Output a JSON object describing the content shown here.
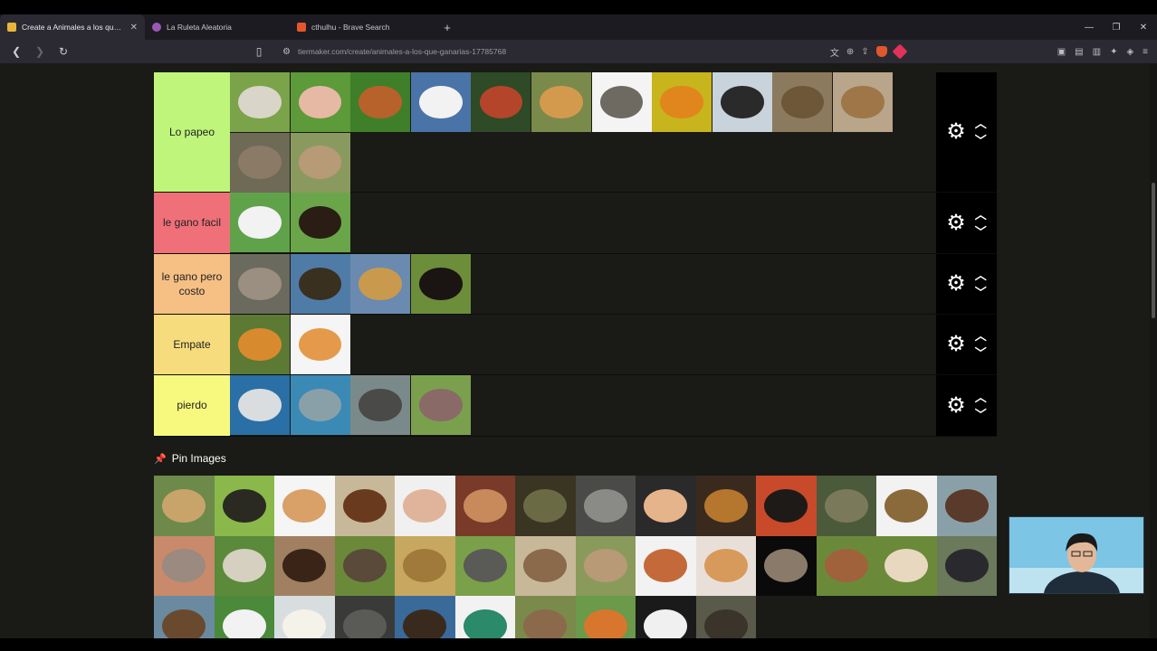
{
  "browser": {
    "tabs": [
      {
        "title": "Create a Animales a los que ganarias",
        "active": true,
        "favicon_color": "#e8b53a"
      },
      {
        "title": "La Ruleta Aleatoria",
        "active": false,
        "favicon_color": "#9b59b6"
      },
      {
        "title": "cthulhu - Brave Search",
        "active": false,
        "favicon_color": "#e2572b"
      }
    ],
    "new_tab": "+",
    "controls": {
      "minimize": "—",
      "maximize": "❐",
      "close": "✕"
    },
    "url": "tiermaker.com/create/animales-a-los-que-ganarias-17785768"
  },
  "tiers": [
    {
      "label": "Lo papeo",
      "color": "#bff57a",
      "items": [
        "sheep",
        "pig",
        "hen",
        "swan",
        "rooster",
        "golden-retriever",
        "greyhound",
        "butterfly",
        "penguins",
        "kangaroo",
        "coyote",
        "lynx",
        "rabbit"
      ]
    },
    {
      "label": "le gano facil",
      "color": "#f0707a",
      "items": [
        "cow",
        "doberman"
      ]
    },
    {
      "label": "le gano pero costo",
      "color": "#f6bf84",
      "items": [
        "wolf",
        "ostrich",
        "giraffe",
        "tasmanian-devil"
      ]
    },
    {
      "label": "Empate",
      "color": "#f7dc7d",
      "items": [
        "tiger",
        "cat"
      ]
    },
    {
      "label": "pierdo",
      "color": "#f7f97e",
      "items": [
        "shark",
        "seal",
        "rhinoceros",
        "hippo"
      ]
    }
  ],
  "pin": {
    "label": "Pin Images",
    "icon": "pin-icon"
  },
  "pool": [
    "cheetah",
    "beetle",
    "chihuahua",
    "ant",
    "man",
    "bruce-lee",
    "old-painting",
    "gigachad",
    "child",
    "lion",
    "bull",
    "crocodile",
    "tortoise",
    "moose",
    "armadillo",
    "cobra",
    "tarantula",
    "anteater",
    "frog",
    "elephant",
    "hyena",
    "meerkats",
    "guinea-pig",
    "hamster",
    "rat",
    "capybara",
    "capuchin",
    "gorilla",
    "bear",
    "panda",
    "polar-bear",
    "rock",
    "eagle",
    "hummingbird",
    "sparrow",
    "robin",
    "pelican",
    "hedgehog"
  ],
  "tile_colors": {
    "sheep": [
      "#7ba34a",
      "#d9d5c8"
    ],
    "pig": [
      "#5c9a3a",
      "#e6b9a4"
    ],
    "hen": [
      "#3f7f2a",
      "#b8622b"
    ],
    "swan": [
      "#4a73a8",
      "#f2f2f2"
    ],
    "rooster": [
      "#2f4a26",
      "#b5452a"
    ],
    "golden-retriever": [
      "#7a8a4a",
      "#d39a4e"
    ],
    "greyhound": [
      "#f4f4f4",
      "#6e6a62"
    ],
    "butterfly": [
      "#c8b41c",
      "#e0861c"
    ],
    "penguins": [
      "#c9d3dc",
      "#2a2a2a"
    ],
    "kangaroo": [
      "#8b7a5e",
      "#6e5638"
    ],
    "coyote": [
      "#b9a58a",
      "#9e7648"
    ],
    "lynx": [
      "#6e6a56",
      "#8a7a66"
    ],
    "rabbit": [
      "#8a9a5e",
      "#b79a76"
    ],
    "cow": [
      "#5fa24a",
      "#f2f2f2"
    ],
    "doberman": [
      "#6aa54a",
      "#2a1d14"
    ],
    "wolf": [
      "#6a6a5e",
      "#9a8f80"
    ],
    "ostrich": [
      "#4f7ca6",
      "#3a3020"
    ],
    "giraffe": [
      "#6a8ab0",
      "#c99a4e"
    ],
    "tasmanian-devil": [
      "#6c8d3a",
      "#1a1412"
    ],
    "tiger": [
      "#5c7a34",
      "#d88a2e"
    ],
    "cat": [
      "#f5f5f5",
      "#e49a4a"
    ],
    "shark": [
      "#2a6fa6",
      "#d9dde0"
    ],
    "seal": [
      "#3a8ab5",
      "#8aa0a8"
    ],
    "rhinoceros": [
      "#7a8a8a",
      "#4a4a48"
    ],
    "hippo": [
      "#7aa04e",
      "#8a6a66"
    ],
    "cheetah": [
      "#6d8a4a",
      "#c9a46a"
    ],
    "beetle": [
      "#8ab84a",
      "#2a2a22"
    ],
    "chihuahua": [
      "#f5f5f5",
      "#d9a068"
    ],
    "ant": [
      "#c8b89a",
      "#6a3a1e"
    ],
    "man": [
      "#f0f0f0",
      "#e0b49a"
    ],
    "bruce-lee": [
      "#7a3a2a",
      "#c88a5a"
    ],
    "old-painting": [
      "#3a3422",
      "#6a6a44"
    ],
    "gigachad": [
      "#4a4a48",
      "#8a8a86"
    ],
    "child": [
      "#2a2a2a",
      "#e6b48a"
    ],
    "lion": [
      "#3a2a1e",
      "#b5762e"
    ],
    "bull": [
      "#c84a2a",
      "#1e1a18"
    ],
    "crocodile": [
      "#4a5a3a",
      "#7a7a5a"
    ],
    "tortoise": [
      "#f2f2f2",
      "#8a6a3a"
    ],
    "moose": [
      "#8aa0a8",
      "#5a3a2a"
    ],
    "armadillo": [
      "#c88a6a",
      "#9a8a80"
    ],
    "cobra": [
      "#5a8a3a",
      "#d6d0c0"
    ],
    "tarantula": [
      "#a08060",
      "#3a2418"
    ],
    "anteater": [
      "#6a8a3a",
      "#5a4a3a"
    ],
    "frog": [
      "#c8a860",
      "#a07a3a"
    ],
    "elephant": [
      "#7aa04a",
      "#5a5a56"
    ],
    "hyena": [
      "#c8b89a",
      "#8a6a4a"
    ],
    "meerkats": [
      "#8a9a5a",
      "#b89a76"
    ],
    "guinea-pig": [
      "#f2f2f2",
      "#c46a3a"
    ],
    "hamster": [
      "#e8e0d8",
      "#d89a5a"
    ],
    "rat": [
      "#0a0a0a",
      "#8a7a6a"
    ],
    "capybara": [
      "#6a8a3a",
      "#a0623a"
    ],
    "capuchin": [
      "#6a8a3a",
      "#e8d8c0"
    ],
    "gorilla": [
      "#6a7a5a",
      "#2a2a2e"
    ],
    "bear": [
      "#6a8aa0",
      "#6a4a2e"
    ],
    "panda": [
      "#4a8a3a",
      "#f2f2f2"
    ],
    "polar-bear": [
      "#d8dde0",
      "#f5f2ea"
    ],
    "rock": [
      "#3a3a38",
      "#5a5a56"
    ],
    "eagle": [
      "#3a6a9a",
      "#3a2a1e"
    ],
    "hummingbird": [
      "#f2f2f2",
      "#2a8a6a"
    ],
    "sparrow": [
      "#7a8a4a",
      "#8a6a4a"
    ],
    "robin": [
      "#6a9a4a",
      "#d8762e"
    ],
    "pelican": [
      "#1a1a1a",
      "#f0f0f0"
    ],
    "hedgehog": [
      "#5a5a4a",
      "#3a342a"
    ]
  }
}
